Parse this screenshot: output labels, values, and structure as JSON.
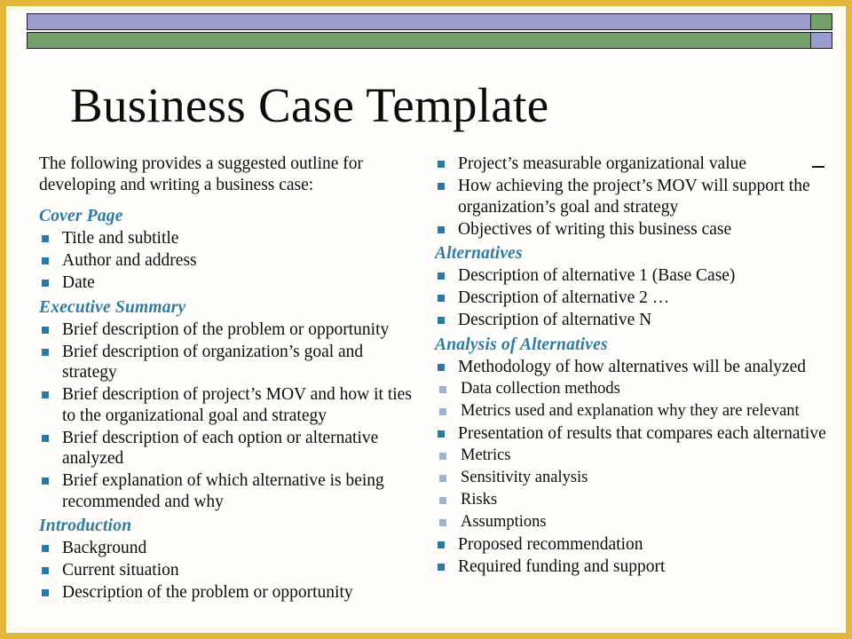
{
  "slide": {
    "title": "Business Case Template",
    "watermark": "www.examplesofresumes.com",
    "colors": {
      "frame_gold": "#e3b838",
      "bar_purple": "#9a9ccd",
      "bar_green": "#74a06c",
      "heading_blue": "#2e7ba6",
      "bullet_level1": "#2878a8",
      "bullet_level2": "#9db4cf",
      "background": "#fffefb",
      "body_text": "#0d0d0d"
    }
  },
  "header_bars": {
    "top_row": [
      {
        "name": "purple-long-bar",
        "color": "purple"
      },
      {
        "name": "green-end-square",
        "color": "green"
      }
    ],
    "bottom_row": [
      {
        "name": "green-long-bar",
        "color": "green"
      },
      {
        "name": "purple-end-square",
        "color": "purple"
      }
    ]
  },
  "left_column": {
    "intro": "The following provides a suggested outline for developing and writing a business case:",
    "sections": [
      {
        "heading": "Cover Page",
        "items": [
          {
            "text": "Title and subtitle",
            "level": 1
          },
          {
            "text": "Author and address",
            "level": 1
          },
          {
            "text": "Date",
            "level": 1
          }
        ]
      },
      {
        "heading": "Executive Summary",
        "items": [
          {
            "text": "Brief description of the problem or opportunity",
            "level": 1
          },
          {
            "text": "Brief description of organization’s goal and strategy",
            "level": 1
          },
          {
            "text": "Brief description of project’s MOV and how it ties to the organizational goal and strategy",
            "level": 1
          },
          {
            "text": "Brief description of each option or alternative analyzed",
            "level": 1
          },
          {
            "text": "Brief explanation of which alternative is being recommended and why",
            "level": 1
          }
        ]
      },
      {
        "heading": "Introduction",
        "items": [
          {
            "text": "Background",
            "level": 1
          },
          {
            "text": "Current situation",
            "level": 1
          },
          {
            "text": "Description of the problem or opportunity",
            "level": 1
          }
        ]
      }
    ]
  },
  "right_column": {
    "lead_items": [
      {
        "text": "Project’s measurable organizational value",
        "level": 1
      },
      {
        "text": "How achieving the project’s MOV will support the organization’s goal and strategy",
        "level": 1
      },
      {
        "text": "Objectives of writing this business case",
        "level": 1
      }
    ],
    "sections": [
      {
        "heading": "Alternatives",
        "items": [
          {
            "text": "Description of alternative 1 (Base Case)",
            "level": 1
          },
          {
            "text": "Description of alternative 2 …",
            "level": 1
          },
          {
            "text": "Description of alternative N",
            "level": 1
          }
        ]
      },
      {
        "heading": "Analysis of Alternatives",
        "items": [
          {
            "text": "Methodology of how alternatives will be analyzed",
            "level": 1
          },
          {
            "text": "Data collection methods",
            "level": 2
          },
          {
            "text": "Metrics used and explanation why they are relevant",
            "level": 2
          },
          {
            "text": "Presentation of results that compares each alternative",
            "level": 1
          },
          {
            "text": "Metrics",
            "level": 2
          },
          {
            "text": "Sensitivity analysis",
            "level": 2
          },
          {
            "text": "Risks",
            "level": 2
          },
          {
            "text": "Assumptions",
            "level": 2
          },
          {
            "text": "Proposed recommendation",
            "level": 1
          },
          {
            "text": "Required funding and support",
            "level": 1
          }
        ]
      }
    ]
  }
}
